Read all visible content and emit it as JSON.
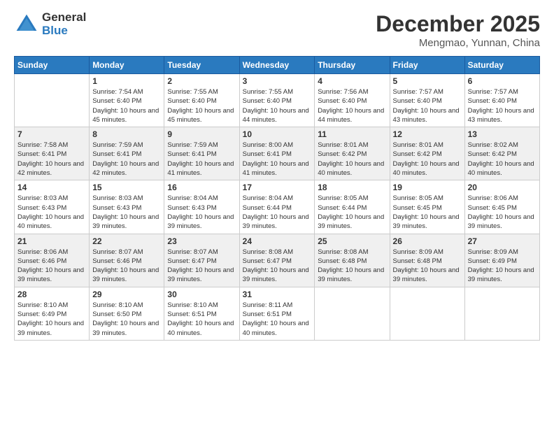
{
  "logo": {
    "general": "General",
    "blue": "Blue"
  },
  "title": "December 2025",
  "subtitle": "Mengmao, Yunnan, China",
  "days_of_week": [
    "Sunday",
    "Monday",
    "Tuesday",
    "Wednesday",
    "Thursday",
    "Friday",
    "Saturday"
  ],
  "weeks": [
    [
      {
        "day": "",
        "sunrise": "",
        "sunset": "",
        "daylight": ""
      },
      {
        "day": "1",
        "sunrise": "Sunrise: 7:54 AM",
        "sunset": "Sunset: 6:40 PM",
        "daylight": "Daylight: 10 hours and 45 minutes."
      },
      {
        "day": "2",
        "sunrise": "Sunrise: 7:55 AM",
        "sunset": "Sunset: 6:40 PM",
        "daylight": "Daylight: 10 hours and 45 minutes."
      },
      {
        "day": "3",
        "sunrise": "Sunrise: 7:55 AM",
        "sunset": "Sunset: 6:40 PM",
        "daylight": "Daylight: 10 hours and 44 minutes."
      },
      {
        "day": "4",
        "sunrise": "Sunrise: 7:56 AM",
        "sunset": "Sunset: 6:40 PM",
        "daylight": "Daylight: 10 hours and 44 minutes."
      },
      {
        "day": "5",
        "sunrise": "Sunrise: 7:57 AM",
        "sunset": "Sunset: 6:40 PM",
        "daylight": "Daylight: 10 hours and 43 minutes."
      },
      {
        "day": "6",
        "sunrise": "Sunrise: 7:57 AM",
        "sunset": "Sunset: 6:40 PM",
        "daylight": "Daylight: 10 hours and 43 minutes."
      }
    ],
    [
      {
        "day": "7",
        "sunrise": "Sunrise: 7:58 AM",
        "sunset": "Sunset: 6:41 PM",
        "daylight": "Daylight: 10 hours and 42 minutes."
      },
      {
        "day": "8",
        "sunrise": "Sunrise: 7:59 AM",
        "sunset": "Sunset: 6:41 PM",
        "daylight": "Daylight: 10 hours and 42 minutes."
      },
      {
        "day": "9",
        "sunrise": "Sunrise: 7:59 AM",
        "sunset": "Sunset: 6:41 PM",
        "daylight": "Daylight: 10 hours and 41 minutes."
      },
      {
        "day": "10",
        "sunrise": "Sunrise: 8:00 AM",
        "sunset": "Sunset: 6:41 PM",
        "daylight": "Daylight: 10 hours and 41 minutes."
      },
      {
        "day": "11",
        "sunrise": "Sunrise: 8:01 AM",
        "sunset": "Sunset: 6:42 PM",
        "daylight": "Daylight: 10 hours and 40 minutes."
      },
      {
        "day": "12",
        "sunrise": "Sunrise: 8:01 AM",
        "sunset": "Sunset: 6:42 PM",
        "daylight": "Daylight: 10 hours and 40 minutes."
      },
      {
        "day": "13",
        "sunrise": "Sunrise: 8:02 AM",
        "sunset": "Sunset: 6:42 PM",
        "daylight": "Daylight: 10 hours and 40 minutes."
      }
    ],
    [
      {
        "day": "14",
        "sunrise": "Sunrise: 8:03 AM",
        "sunset": "Sunset: 6:43 PM",
        "daylight": "Daylight: 10 hours and 40 minutes."
      },
      {
        "day": "15",
        "sunrise": "Sunrise: 8:03 AM",
        "sunset": "Sunset: 6:43 PM",
        "daylight": "Daylight: 10 hours and 39 minutes."
      },
      {
        "day": "16",
        "sunrise": "Sunrise: 8:04 AM",
        "sunset": "Sunset: 6:43 PM",
        "daylight": "Daylight: 10 hours and 39 minutes."
      },
      {
        "day": "17",
        "sunrise": "Sunrise: 8:04 AM",
        "sunset": "Sunset: 6:44 PM",
        "daylight": "Daylight: 10 hours and 39 minutes."
      },
      {
        "day": "18",
        "sunrise": "Sunrise: 8:05 AM",
        "sunset": "Sunset: 6:44 PM",
        "daylight": "Daylight: 10 hours and 39 minutes."
      },
      {
        "day": "19",
        "sunrise": "Sunrise: 8:05 AM",
        "sunset": "Sunset: 6:45 PM",
        "daylight": "Daylight: 10 hours and 39 minutes."
      },
      {
        "day": "20",
        "sunrise": "Sunrise: 8:06 AM",
        "sunset": "Sunset: 6:45 PM",
        "daylight": "Daylight: 10 hours and 39 minutes."
      }
    ],
    [
      {
        "day": "21",
        "sunrise": "Sunrise: 8:06 AM",
        "sunset": "Sunset: 6:46 PM",
        "daylight": "Daylight: 10 hours and 39 minutes."
      },
      {
        "day": "22",
        "sunrise": "Sunrise: 8:07 AM",
        "sunset": "Sunset: 6:46 PM",
        "daylight": "Daylight: 10 hours and 39 minutes."
      },
      {
        "day": "23",
        "sunrise": "Sunrise: 8:07 AM",
        "sunset": "Sunset: 6:47 PM",
        "daylight": "Daylight: 10 hours and 39 minutes."
      },
      {
        "day": "24",
        "sunrise": "Sunrise: 8:08 AM",
        "sunset": "Sunset: 6:47 PM",
        "daylight": "Daylight: 10 hours and 39 minutes."
      },
      {
        "day": "25",
        "sunrise": "Sunrise: 8:08 AM",
        "sunset": "Sunset: 6:48 PM",
        "daylight": "Daylight: 10 hours and 39 minutes."
      },
      {
        "day": "26",
        "sunrise": "Sunrise: 8:09 AM",
        "sunset": "Sunset: 6:48 PM",
        "daylight": "Daylight: 10 hours and 39 minutes."
      },
      {
        "day": "27",
        "sunrise": "Sunrise: 8:09 AM",
        "sunset": "Sunset: 6:49 PM",
        "daylight": "Daylight: 10 hours and 39 minutes."
      }
    ],
    [
      {
        "day": "28",
        "sunrise": "Sunrise: 8:10 AM",
        "sunset": "Sunset: 6:49 PM",
        "daylight": "Daylight: 10 hours and 39 minutes."
      },
      {
        "day": "29",
        "sunrise": "Sunrise: 8:10 AM",
        "sunset": "Sunset: 6:50 PM",
        "daylight": "Daylight: 10 hours and 39 minutes."
      },
      {
        "day": "30",
        "sunrise": "Sunrise: 8:10 AM",
        "sunset": "Sunset: 6:51 PM",
        "daylight": "Daylight: 10 hours and 40 minutes."
      },
      {
        "day": "31",
        "sunrise": "Sunrise: 8:11 AM",
        "sunset": "Sunset: 6:51 PM",
        "daylight": "Daylight: 10 hours and 40 minutes."
      },
      {
        "day": "",
        "sunrise": "",
        "sunset": "",
        "daylight": ""
      },
      {
        "day": "",
        "sunrise": "",
        "sunset": "",
        "daylight": ""
      },
      {
        "day": "",
        "sunrise": "",
        "sunset": "",
        "daylight": ""
      }
    ]
  ]
}
